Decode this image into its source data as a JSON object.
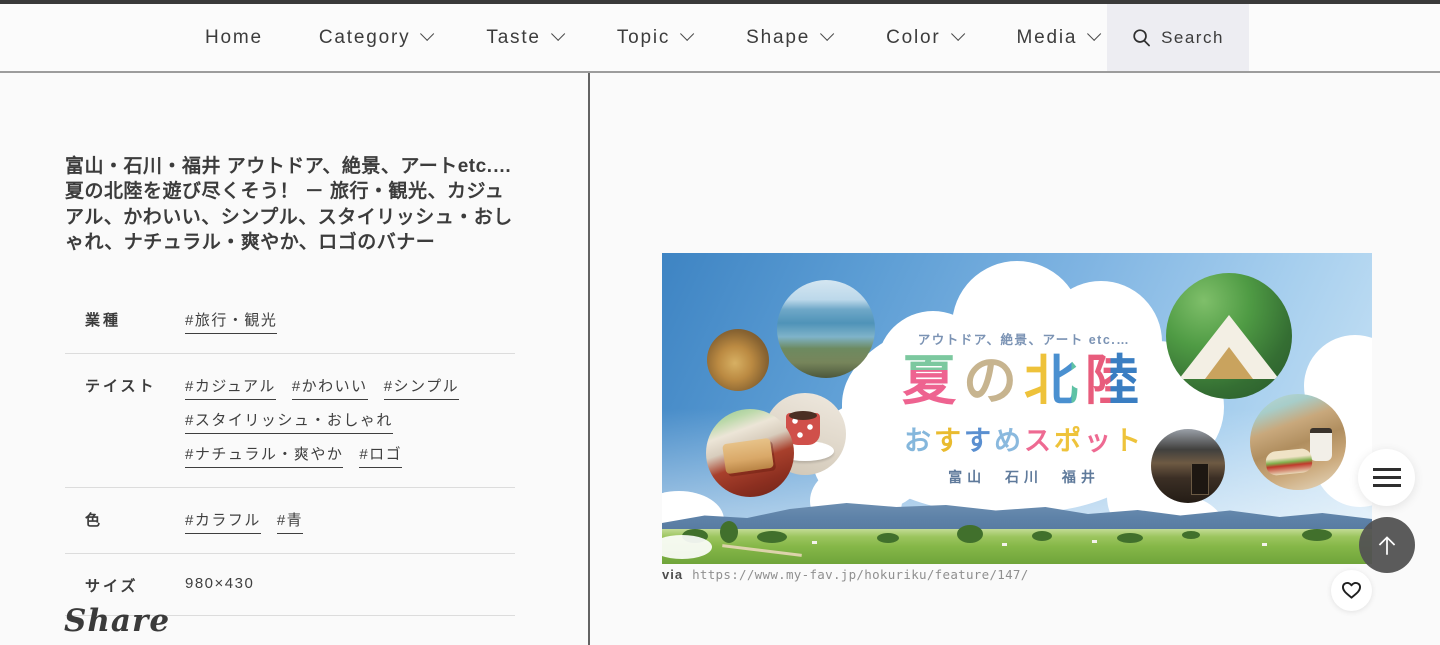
{
  "nav": {
    "items": [
      {
        "label": "Home",
        "dropdown": false
      },
      {
        "label": "Category",
        "dropdown": true
      },
      {
        "label": "Taste",
        "dropdown": true
      },
      {
        "label": "Topic",
        "dropdown": true
      },
      {
        "label": "Shape",
        "dropdown": true
      },
      {
        "label": "Color",
        "dropdown": true
      },
      {
        "label": "Media",
        "dropdown": true
      }
    ],
    "search_label": "Search"
  },
  "detail": {
    "title": "富山・石川・福井 アウトドア、絶景、アートetc.… 夏の北陸を遊び尽くそう！ － 旅行・観光、カジュアル、かわいい、シンプル、スタイリッシュ・おしゃれ、ナチュラル・爽やか、ロゴのバナー",
    "rows": [
      {
        "label": "業種",
        "tags": [
          "#旅行・観光"
        ]
      },
      {
        "label": "テイスト",
        "tags": [
          "#カジュアル",
          "#かわいい",
          "#シンプル",
          "#スタイリッシュ・おしゃれ",
          "#ナチュラル・爽やか",
          "#ロゴ"
        ]
      },
      {
        "label": "色",
        "tags": [
          "#カラフル",
          "#青"
        ]
      },
      {
        "label": "サイズ",
        "value": "980×430"
      }
    ],
    "share_label": "Share"
  },
  "banner": {
    "tagline": "アウトドア、絶景、アート etc.…",
    "title_chars": [
      {
        "ch": "夏",
        "colors": [
          "#7cc89f",
          "#ee6390"
        ],
        "dir": "180deg",
        "stops": [
          "32%"
        ]
      },
      {
        "ch": "の",
        "colors": [
          "#c7b48f"
        ]
      },
      {
        "ch": "北",
        "colors": [
          "#eec23a",
          "#4a90d0",
          "#5fc2a5"
        ],
        "dir": "90deg",
        "stops": [
          "45%",
          "78%"
        ]
      },
      {
        "ch": "陸",
        "colors": [
          "#e85c7c",
          "#3a7ec2"
        ],
        "dir": "90deg",
        "stops": [
          "42%"
        ]
      }
    ],
    "subtitle_chars": [
      {
        "ch": "お",
        "colors": [
          "#85b7dc"
        ]
      },
      {
        "ch": "す",
        "colors": [
          "#e9bb2f"
        ]
      },
      {
        "ch": "す",
        "colors": [
          "#5a8fd0"
        ]
      },
      {
        "ch": "め",
        "colors": [
          "#8ab9de"
        ]
      },
      {
        "ch": "ス",
        "colors": [
          "#ee6a92"
        ]
      },
      {
        "ch": "ポ",
        "colors": [
          "#eec33b"
        ]
      },
      {
        "ch": "ッ",
        "colors": [
          "#ee6a92"
        ]
      },
      {
        "ch": "ト",
        "colors": [
          "#eec33b"
        ]
      }
    ],
    "regions": "富山 石川 福井"
  },
  "via": {
    "prefix": "via",
    "url": "https://www.my-fav.jp/hokuriku/feature/147/"
  },
  "icons": {
    "search": "magnifier-icon",
    "nav_dropdown": "chevron-down-icon",
    "menu": "hamburger-menu-icon",
    "back_to_top": "arrow-up-icon",
    "favorite": "heart-outline-icon"
  },
  "colors": {
    "top_border": "#3a3a3a",
    "search_bg": "#ededf2",
    "divider": "#dcdcdc",
    "text_main": "#3c3c3c",
    "via_url": "#8f8f8f",
    "sky_blue": "#5c9dd4",
    "field_green": "#85b748",
    "back_to_top_bg": "#525252"
  }
}
